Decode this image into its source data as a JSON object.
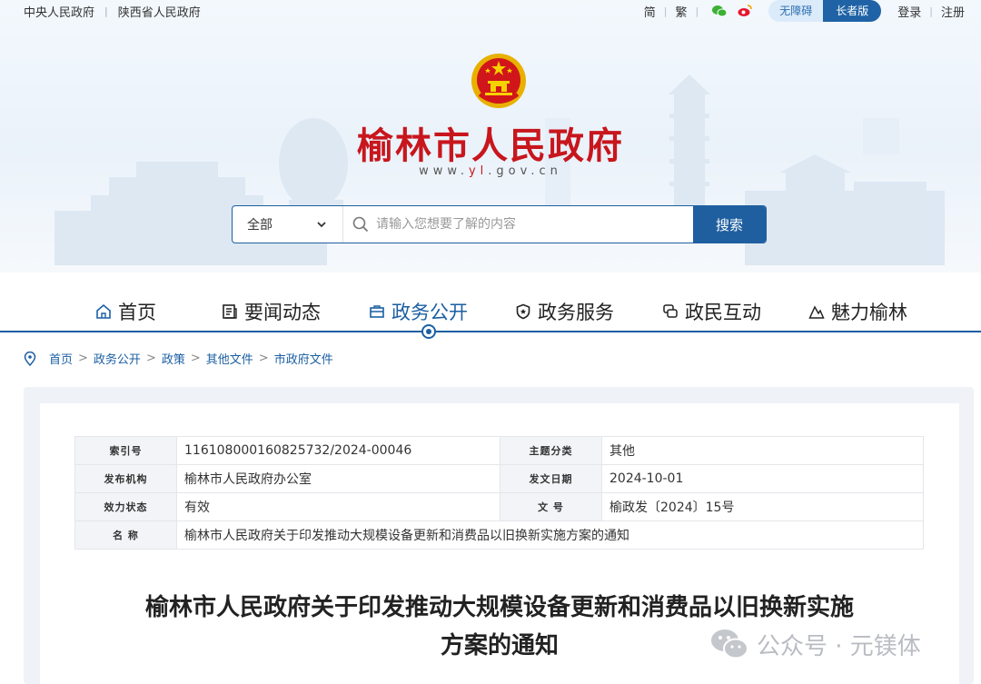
{
  "topbar": {
    "left_links": [
      "中央人民政府",
      "陕西省人民政府"
    ],
    "lang_simplified": "简",
    "lang_traditional": "繁",
    "accessible_label": "无障碍",
    "elder_label": "长者版",
    "login_label": "登录",
    "logout_label": "注册"
  },
  "header": {
    "site_title": "榆林市人民政府",
    "url_prefix": "www.",
    "url_highlight": "yl",
    "url_suffix": ".gov.cn"
  },
  "search": {
    "scope_value": "全部",
    "placeholder": "请输入您想要了解的内容",
    "button_label": "搜索"
  },
  "nav": {
    "items": [
      {
        "label": "首页",
        "icon": "home-icon"
      },
      {
        "label": "要闻动态",
        "icon": "news-icon"
      },
      {
        "label": "政务公开",
        "icon": "briefcase-icon",
        "active": true
      },
      {
        "label": "政务服务",
        "icon": "shield-icon"
      },
      {
        "label": "政民互动",
        "icon": "chat-icon"
      },
      {
        "label": "魅力榆林",
        "icon": "mountain-icon"
      }
    ]
  },
  "breadcrumb": [
    "首页",
    "政务公开",
    "政策",
    "其他文件",
    "市政府文件"
  ],
  "meta": {
    "index_no_label": "索引号",
    "index_no": "11610800016082573 2/2024-00046",
    "topic_label": "主题分类",
    "topic": "其他",
    "issuer_label": "发布机构",
    "issuer": "榆林市人民政府办公室",
    "date_label": "发文日期",
    "date": "2024-10-01",
    "status_label": "效力状态",
    "status": "有效",
    "doc_no_label": "文  号",
    "doc_no": "榆政发〔2024〕15号",
    "name_label": "名  称",
    "name": "榆林市人民政府关于印发推动大规模设备更新和消费品以旧换新实施方案的通知"
  },
  "document": {
    "title_line1": "榆林市人民政府关于印发推动大规模设备更新和消费品以旧换新实施",
    "title_line2": "方案的通知"
  },
  "watermark": {
    "text": "公众号 · 元镁体"
  },
  "colors": {
    "brand_blue": "#1f5fa0",
    "title_red": "#c8161d"
  }
}
